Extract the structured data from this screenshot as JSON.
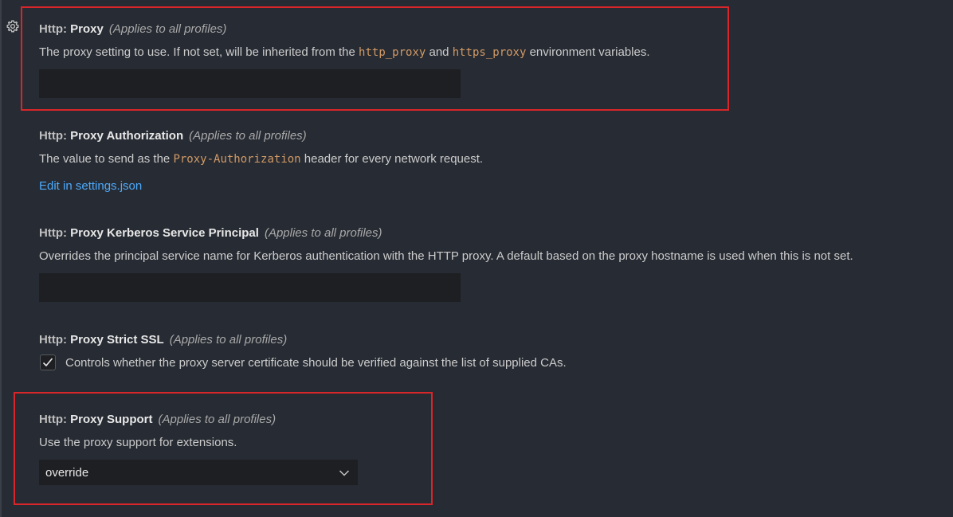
{
  "settings": [
    {
      "category": "Http: ",
      "name": "Proxy",
      "scope": "(Applies to all profiles)",
      "desc_pre": "The proxy setting to use. If not set, will be inherited from the ",
      "code1": "http_proxy",
      "desc_mid": " and ",
      "code2": "https_proxy",
      "desc_post": " environment variables.",
      "value": ""
    },
    {
      "category": "Http: ",
      "name": "Proxy Authorization",
      "scope": "(Applies to all profiles)",
      "desc_pre": "The value to send as the ",
      "code1": "Proxy-Authorization",
      "desc_post": " header for every network request.",
      "link": "Edit in settings.json"
    },
    {
      "category": "Http: ",
      "name": "Proxy Kerberos Service Principal",
      "scope": "(Applies to all profiles)",
      "desc": "Overrides the principal service name for Kerberos authentication with the HTTP proxy. A default based on the proxy hostname is used when this is not set.",
      "value": ""
    },
    {
      "category": "Http: ",
      "name": "Proxy Strict SSL",
      "scope": "(Applies to all profiles)",
      "checkbox_label": "Controls whether the proxy server certificate should be verified against the list of supplied CAs.",
      "checked": true
    },
    {
      "category": "Http: ",
      "name": "Proxy Support",
      "scope": "(Applies to all profiles)",
      "desc": "Use the proxy support for extensions.",
      "selected": "override"
    }
  ],
  "colors": {
    "background": "#272b33",
    "input_background": "#1e1f22",
    "code": "#d19a66",
    "link": "#4daafc",
    "highlight": "#d9262a"
  },
  "icons": {
    "gear": "gear-icon",
    "check": "check-icon",
    "chevron": "chevron-down-icon"
  }
}
